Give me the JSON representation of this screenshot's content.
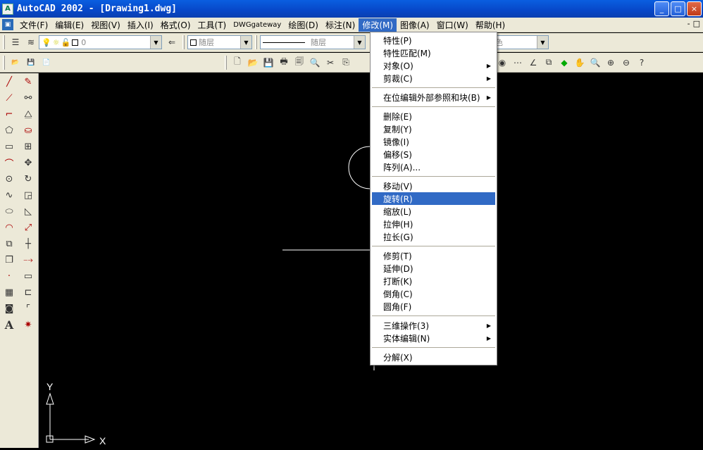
{
  "window": {
    "title": "AutoCAD 2002 - [Drawing1.dwg]",
    "minimize": "_",
    "maximize": "□",
    "close": "×"
  },
  "menubar": {
    "items": [
      "文件(F)",
      "编辑(E)",
      "视图(V)",
      "插入(I)",
      "格式(O)",
      "工具(T)",
      "DWGgateway",
      "绘图(D)",
      "标注(N)",
      "修改(M)",
      "图像(A)",
      "窗口(W)",
      "帮助(H)"
    ],
    "active": "修改(M)",
    "mdi_minimize": "-",
    "mdi_restore": "□"
  },
  "layer_toolbar": {
    "layer_value": "0",
    "color_value": "随层",
    "linetype_value": "随层",
    "lineweight_value": "色"
  },
  "modify_menu": {
    "groups": [
      [
        {
          "label": "特性(P)"
        },
        {
          "label": "特性匹配(M)"
        },
        {
          "label": "对象(O)",
          "sub": true
        },
        {
          "label": "剪裁(C)",
          "sub": true
        }
      ],
      [
        {
          "label": "在位编辑外部参照和块(B)",
          "sub": true
        }
      ],
      [
        {
          "label": "删除(E)"
        },
        {
          "label": "复制(Y)"
        },
        {
          "label": "镜像(I)"
        },
        {
          "label": "偏移(S)"
        },
        {
          "label": "阵列(A)..."
        }
      ],
      [
        {
          "label": "移动(V)"
        },
        {
          "label": "旋转(R)",
          "highlighted": true
        },
        {
          "label": "缩放(L)"
        },
        {
          "label": "拉伸(H)"
        },
        {
          "label": "拉长(G)"
        }
      ],
      [
        {
          "label": "修剪(T)"
        },
        {
          "label": "延伸(D)"
        },
        {
          "label": "打断(K)"
        },
        {
          "label": "倒角(C)"
        },
        {
          "label": "圆角(F)"
        }
      ],
      [
        {
          "label": "三维操作(3)",
          "sub": true
        },
        {
          "label": "实体编辑(N)",
          "sub": true
        }
      ],
      [
        {
          "label": "分解(X)"
        }
      ]
    ]
  },
  "ucs": {
    "x_label": "X",
    "y_label": "Y"
  },
  "left_toolbar_icons": [
    "line-icon",
    "construction-line-icon",
    "polyline-icon",
    "polygon-icon",
    "rectangle-icon",
    "arc-icon",
    "circle-icon",
    "spline-icon",
    "ellipse-icon",
    "ellipse-arc-icon",
    "insert-block-icon",
    "make-block-icon",
    "point-icon",
    "hatch-icon",
    "region-icon",
    "text-icon"
  ],
  "modify_toolbar_icons": [
    "erase-icon",
    "copy-icon",
    "mirror-icon",
    "offset-icon",
    "array-icon",
    "move-icon",
    "rotate-icon",
    "scale-icon",
    "stretch-icon",
    "lengthen-icon",
    "trim-icon",
    "extend-icon",
    "break-icon",
    "chamfer-icon",
    "fillet-icon",
    "explode-icon"
  ],
  "text_icon_glyph": "A"
}
